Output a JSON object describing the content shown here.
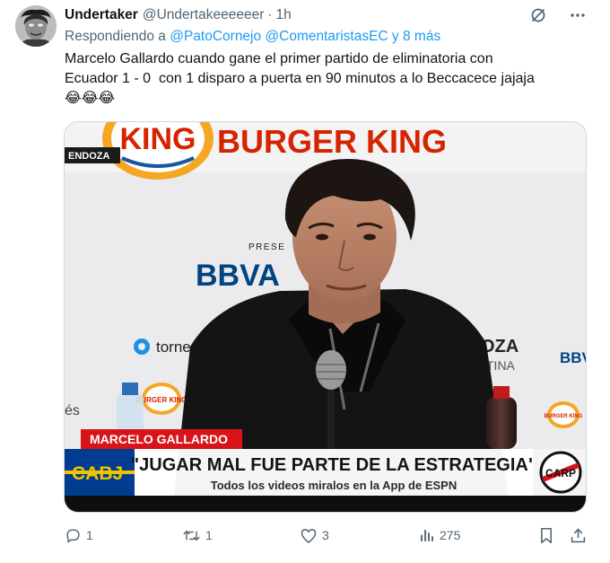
{
  "author": {
    "display_name": "Undertaker",
    "handle": "@Undertakeeeeeer",
    "separator": "·",
    "time": "1h"
  },
  "reply_context": {
    "prefix": "Respondiendo a",
    "mentions": "@PatoCornejo @ComentaristasEC y 8 más"
  },
  "tweet": {
    "line1": "Marcelo Gallardo cuando gane el primer partido de eliminatoria con",
    "line2": "Ecuador 1 - 0  con 1 disparo a puerta en 90 minutos a lo Beccacece jajaja",
    "emojis": "😂😂😂"
  },
  "media": {
    "sponsor_top": "BURGER KING",
    "corner_tag": "ENDOZA",
    "presents": "PRESE",
    "bank": "BBVA",
    "tech_sponsor": "torne",
    "right_sponsor_1": "OZA",
    "right_sponsor_2": "TINA",
    "right_bank": "BBV",
    "left_partial": "és",
    "bk_badge_1": "BURGER KING",
    "bk_badge_2": "BURGER KING",
    "lower_third_name": "MARCELO GALLARDO",
    "headline": "\"JUGAR MAL FUE PARTE DE LA ESTRATEGIA\"",
    "subline": "Todos los videos miralos en la App de ESPN",
    "left_club": "CABJ",
    "right_club": "CARP"
  },
  "actions": {
    "replies": "1",
    "retweets": "1",
    "likes": "3",
    "views": "275"
  },
  "colors": {
    "link": "#1d9bf0",
    "secondary_text": "#536471",
    "primary_text": "#0f1419",
    "bk_red": "#d62300",
    "bk_orange": "#f5a623",
    "bbva_blue": "#004481",
    "lower_third_red": "#d8141a",
    "cabj_blue": "#003d8f",
    "cabj_gold": "#f2c400"
  }
}
